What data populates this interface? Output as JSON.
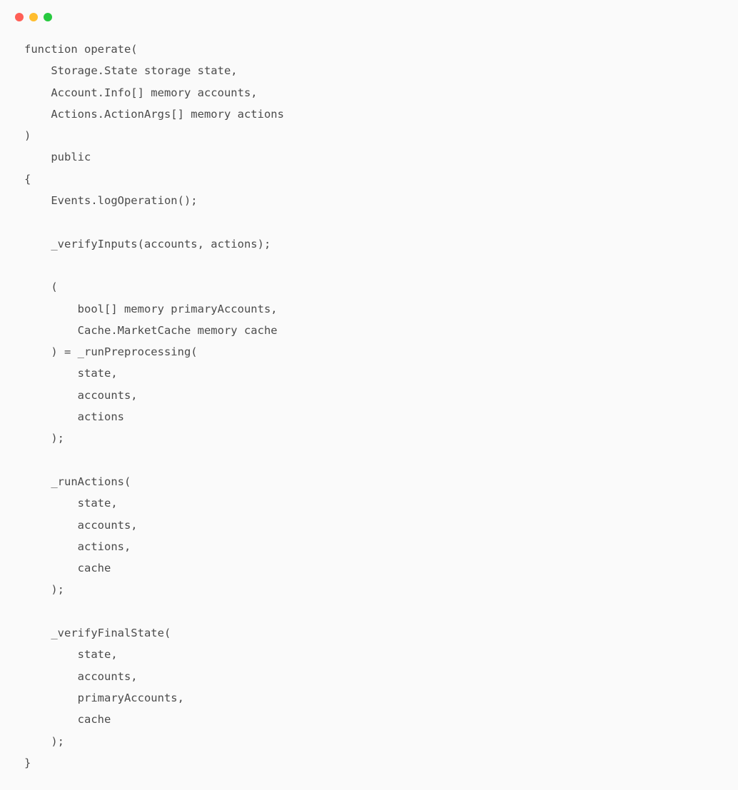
{
  "window": {
    "buttons": {
      "close": "close",
      "minimize": "minimize",
      "maximize": "maximize"
    }
  },
  "code": {
    "lines": [
      "function operate(",
      "    Storage.State storage state,",
      "    Account.Info[] memory accounts,",
      "    Actions.ActionArgs[] memory actions",
      ")",
      "    public",
      "{",
      "    Events.logOperation();",
      "",
      "    _verifyInputs(accounts, actions);",
      "",
      "    (",
      "        bool[] memory primaryAccounts,",
      "        Cache.MarketCache memory cache",
      "    ) = _runPreprocessing(",
      "        state,",
      "        accounts,",
      "        actions",
      "    );",
      "",
      "    _runActions(",
      "        state,",
      "        accounts,",
      "        actions,",
      "        cache",
      "    );",
      "",
      "    _verifyFinalState(",
      "        state,",
      "        accounts,",
      "        primaryAccounts,",
      "        cache",
      "    );",
      "}"
    ]
  }
}
